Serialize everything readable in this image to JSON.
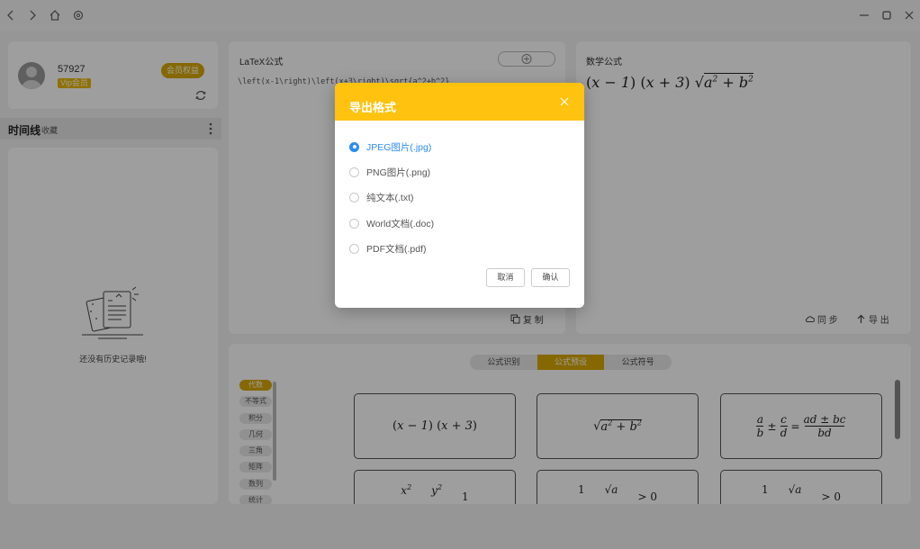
{
  "user": {
    "name": "57927",
    "vip_badge": "Vip会员",
    "member_button": "会员权益"
  },
  "timeline": {
    "title": "时间线",
    "subtitle": "收藏",
    "empty_text": "还没有历史记录哦!"
  },
  "latex_pane": {
    "label": "LaTeX公式",
    "code": "\\left(x-1\\right)\\left(x+3\\right)\\sqrt{a^2+b^2}",
    "copy_button": "复 制"
  },
  "math_pane": {
    "label": "数学公式",
    "sync_button": "同 步",
    "export_button": "导 出"
  },
  "bottom_tabs": [
    "公式识别",
    "公式预设",
    "公式符号"
  ],
  "active_tab": "公式预设",
  "categories": [
    "代数",
    "不等式",
    "积分",
    "几何",
    "三角",
    "矩阵",
    "数列",
    "统计"
  ],
  "active_category": "代数",
  "dialog": {
    "title": "导出格式",
    "options": [
      "JPEG图片(.jpg)",
      "PNG图片(.png)",
      "纯文本(.txt)",
      "World文档(.doc)",
      "PDF文档(.pdf)"
    ],
    "selected": "JPEG图片(.jpg)",
    "cancel_button": "取消",
    "confirm_button": "确认"
  },
  "colors": {
    "accent": "#ffc20e",
    "accent_dark": "#d9a800",
    "selected_blue": "#2c8cf0"
  }
}
